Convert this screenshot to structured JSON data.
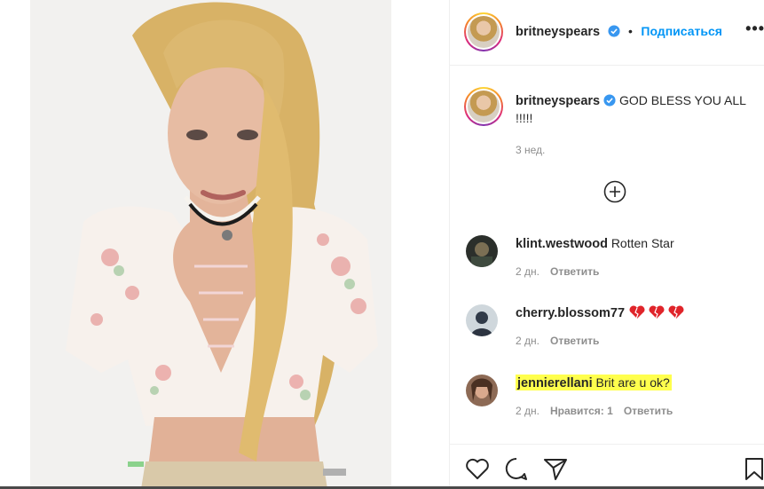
{
  "post": {
    "username": "britneyspears",
    "follow_label": "Подписаться",
    "more_label": "•••",
    "caption": "GOD BLESS YOU ALL !!!!!",
    "time_ago": "3 нед."
  },
  "comments": [
    {
      "username": "klint.westwood",
      "text": "Rotten Star",
      "time": "2 дн.",
      "reply": "Ответить"
    },
    {
      "username": "cherry.blossom77",
      "text": "",
      "time": "2 дн.",
      "reply": "Ответить"
    },
    {
      "username": "jennierellani",
      "text": "Brit are u ok?",
      "time": "2 дн.",
      "likes": "Нравится: 1",
      "reply": "Ответить"
    }
  ],
  "colors": {
    "accent": "#0095f6",
    "highlight": "#ffff4d",
    "verified": "#3897f0"
  },
  "icons": [
    "verified-badge-icon",
    "plus-circle-icon",
    "heart-icon",
    "comment-icon",
    "share-icon",
    "bookmark-icon"
  ]
}
